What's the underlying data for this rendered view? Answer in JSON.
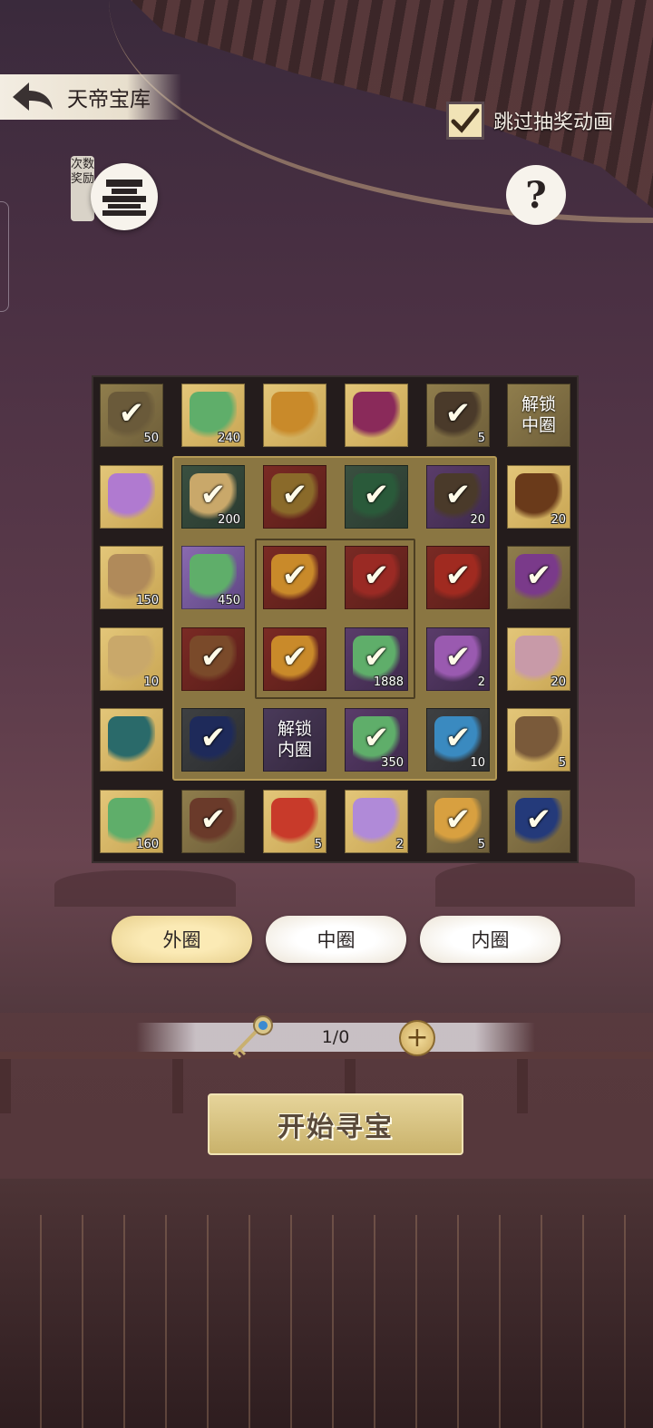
{
  "header": {
    "title": "天帝宝库",
    "skip_animation_label": "跳过抽奖动画",
    "skip_animation_checked": true,
    "reward_tag": "次数奖励",
    "help_label": "?"
  },
  "board": {
    "outer": [
      {
        "icon": "hand-item-icon",
        "color": "dim",
        "count": "50",
        "claimed": true
      },
      {
        "icon": "jade-pendant-icon",
        "color": "gold",
        "count": "240",
        "claimed": false
      },
      {
        "icon": "treasure-chest-icon",
        "color": "gold",
        "count": "",
        "claimed": false
      },
      {
        "icon": "book-icon",
        "color": "gold",
        "count": "",
        "claimed": false
      },
      {
        "icon": "shield-icon",
        "color": "dim",
        "count": "5",
        "claimed": true
      },
      {
        "icon": "unlock-label",
        "color": "dim",
        "count": "",
        "claimed": false,
        "text": "解锁\n中圈"
      },
      {
        "icon": "purple-chest-icon",
        "color": "gold",
        "count": "",
        "claimed": false
      },
      {
        "icon": "seeds-icon",
        "color": "gold",
        "count": "20",
        "claimed": false
      },
      {
        "icon": "ore-icon",
        "color": "gold",
        "count": "150",
        "claimed": false
      },
      {
        "icon": "flower-icon",
        "color": "dim",
        "count": "",
        "claimed": true
      },
      {
        "icon": "scroll-icon",
        "color": "gold",
        "count": "10",
        "claimed": false
      },
      {
        "icon": "orb-icon",
        "color": "gold",
        "count": "20",
        "claimed": false
      },
      {
        "icon": "teal-book-icon",
        "color": "gold",
        "count": "",
        "claimed": false
      },
      {
        "icon": "wooden-chest-icon",
        "color": "gold",
        "count": "5",
        "claimed": false
      },
      {
        "icon": "jade-pendant-icon",
        "color": "gold",
        "count": "160",
        "claimed": false
      },
      {
        "icon": "brown-book-icon",
        "color": "dim",
        "count": "",
        "claimed": true
      },
      {
        "icon": "red-orb-icon",
        "color": "gold",
        "count": "5",
        "claimed": false
      },
      {
        "icon": "butterfly-icon",
        "color": "gold",
        "count": "2",
        "claimed": false
      },
      {
        "icon": "gold-coin-icon",
        "color": "dim",
        "count": "5",
        "claimed": true
      },
      {
        "icon": "blue-book-icon",
        "color": "dim",
        "count": "",
        "claimed": true
      }
    ],
    "middle": [
      {
        "icon": "scroll-icon",
        "color": "green",
        "count": "200",
        "claimed": true
      },
      {
        "icon": "gourd-icon",
        "color": "red",
        "count": "",
        "claimed": true
      },
      {
        "icon": "green-book-icon",
        "color": "green",
        "count": "",
        "claimed": true
      },
      {
        "icon": "shield-icon",
        "color": "violet",
        "count": "20",
        "claimed": true
      },
      {
        "icon": "jade-pendant-icon",
        "color": "purple",
        "count": "450",
        "claimed": false
      },
      {
        "icon": "red-pouch-icon",
        "color": "red",
        "count": "",
        "claimed": true
      },
      {
        "icon": "dark-chest-icon",
        "color": "red",
        "count": "",
        "claimed": true
      },
      {
        "icon": "lotus-icon",
        "color": "violet",
        "count": "2",
        "claimed": true
      },
      {
        "icon": "navy-book-icon",
        "color": "grey",
        "count": "",
        "claimed": true
      },
      {
        "icon": "unlock-label",
        "color": "dpurple",
        "count": "",
        "claimed": false,
        "text": "解锁\n内圈"
      },
      {
        "icon": "jade-pendant-icon",
        "color": "violet",
        "count": "350",
        "claimed": true
      },
      {
        "icon": "water-icon",
        "color": "grey",
        "count": "10",
        "claimed": true
      }
    ],
    "inner": [
      {
        "icon": "treasure-chest-icon",
        "color": "red",
        "count": "",
        "claimed": true
      },
      {
        "icon": "red-chest-icon",
        "color": "red",
        "count": "",
        "claimed": true
      },
      {
        "icon": "treasure-chest-icon",
        "color": "red",
        "count": "",
        "claimed": true
      },
      {
        "icon": "jade-pendant-icon",
        "color": "violet",
        "count": "1888",
        "claimed": true
      }
    ]
  },
  "ring_tabs": [
    {
      "label": "外圈",
      "active": true
    },
    {
      "label": "中圈",
      "active": false
    },
    {
      "label": "内圈",
      "active": false
    }
  ],
  "keys": {
    "count": "1/0",
    "plus": "+"
  },
  "start_button": {
    "label": "开始寻宝"
  },
  "colors": {
    "gold_tile": "#e3c679",
    "board_bg": "#241c1c",
    "middle_ring": "#8a7642",
    "accent": "#f1e3b6"
  }
}
